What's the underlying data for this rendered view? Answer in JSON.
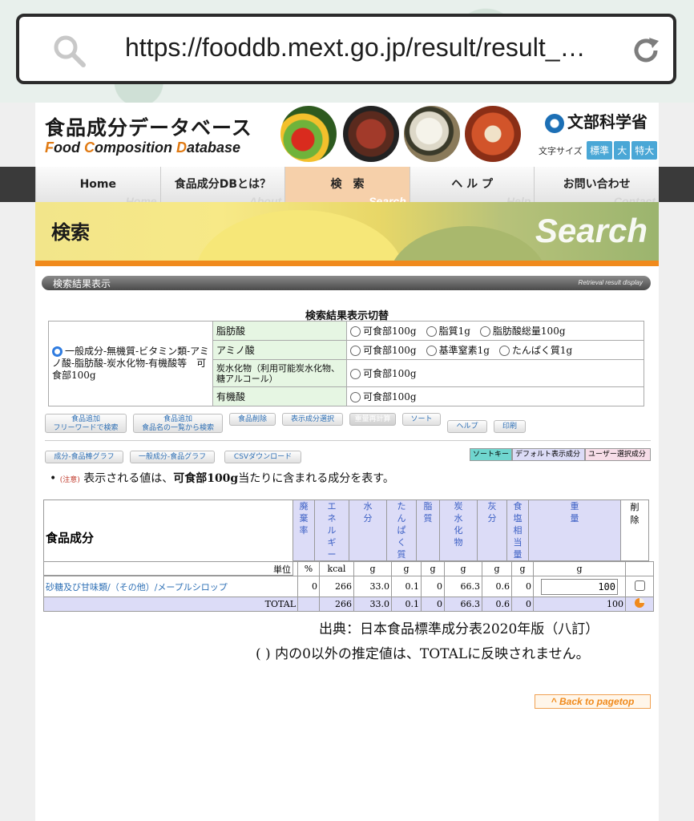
{
  "browser": {
    "url": "https://fooddb.mext.go.jp/result/result_…"
  },
  "header": {
    "logo_jp": "食品成分データベース",
    "logo_en_parts": [
      "F",
      "ood ",
      "C",
      "omposition ",
      "D",
      "atabase"
    ],
    "ministry": "文部科学省",
    "fontsize_label": "文字サイズ",
    "fontsize_options": [
      "標準",
      "大",
      "特大"
    ]
  },
  "nav": [
    {
      "label": "Home",
      "ghost": "Home"
    },
    {
      "label": "食品成分DBとは？",
      "ghost": "About"
    },
    {
      "label": "検　索",
      "ghost": "Search"
    },
    {
      "label": "ヘ ル プ",
      "ghost": "Help"
    },
    {
      "label": "お問い合わせ",
      "ghost": "Contact"
    }
  ],
  "banner": {
    "title": "検索",
    "en": "Search"
  },
  "section": {
    "title": "検索結果表示",
    "en": "Retrieval result display"
  },
  "switch": {
    "title": "検索結果表示切替",
    "main_option": "一般成分-無機質-ビタミン類-アミノ酸-脂肪酸-炭水化物-有機酸等　可食部100g",
    "rows": [
      {
        "label": "脂肪酸",
        "options": [
          "可食部100g",
          "脂質1g",
          "脂肪酸総量100g"
        ]
      },
      {
        "label": "アミノ酸",
        "options": [
          "可食部100g",
          "基準窒素1g",
          "たんぱく質1g"
        ]
      },
      {
        "label": "炭水化物（利用可能炭水化物、糖アルコール）",
        "options": [
          "可食部100g"
        ]
      },
      {
        "label": "有機酸",
        "options": [
          "可食部100g"
        ]
      }
    ]
  },
  "buttons": {
    "add_free_1": "食品追加",
    "add_free_2": "フリーワードで検索",
    "add_list_1": "食品追加",
    "add_list_2": "食品名の一覧から検索",
    "delete": "食品削除",
    "display": "表示成分選択",
    "recalc": "重量再計算",
    "sort": "ソート",
    "help": "ヘルプ",
    "print": "印刷",
    "graph_bar": "成分-食品棒グラフ",
    "graph_general": "一般成分-食品グラフ",
    "csv": "CSVダウンロード"
  },
  "legend": {
    "sort_key": "ソートキー",
    "default": "デフォルト表示成分",
    "user": "ユーザー選択成分"
  },
  "note": {
    "prefix": "(注意)",
    "text1": "表示される値は、",
    "bold": "可食部100g",
    "text2": "当たりに含まれる成分を表す。"
  },
  "table": {
    "title": "食品成分",
    "columns": [
      "廃棄率",
      "エネルギー",
      "水分",
      "たんぱく質",
      "脂質",
      "炭水化物",
      "灰分",
      "食塩相当量",
      "重量",
      "削除"
    ],
    "unit_label": "単位",
    "units": [
      "%",
      "kcal",
      "g",
      "g",
      "g",
      "g",
      "g",
      "g",
      "g"
    ],
    "food_name": "砂糖及び甘味類/（その他）/メープルシロップ",
    "food_values": [
      "0",
      "266",
      "33.0",
      "0.1",
      "0",
      "66.3",
      "0.6",
      "0"
    ],
    "weight": "100",
    "total_label": "TOTAL",
    "total_values": [
      "266",
      "33.0",
      "0.1",
      "0",
      "66.3",
      "0.6",
      "0",
      "100"
    ]
  },
  "citation": {
    "line1": "出典：日本食品標準成分表2020年版（八訂）",
    "line2": "( ) 内の0以外の推定値は、TOTALに反映されません。"
  },
  "back_to_top": "^ Back to pagetop",
  "colors": {
    "accent_orange": "#f08a1c",
    "link_blue": "#2d6fb5",
    "header_lavender": "#dcdcf7",
    "label_green": "#e6f6e3"
  }
}
